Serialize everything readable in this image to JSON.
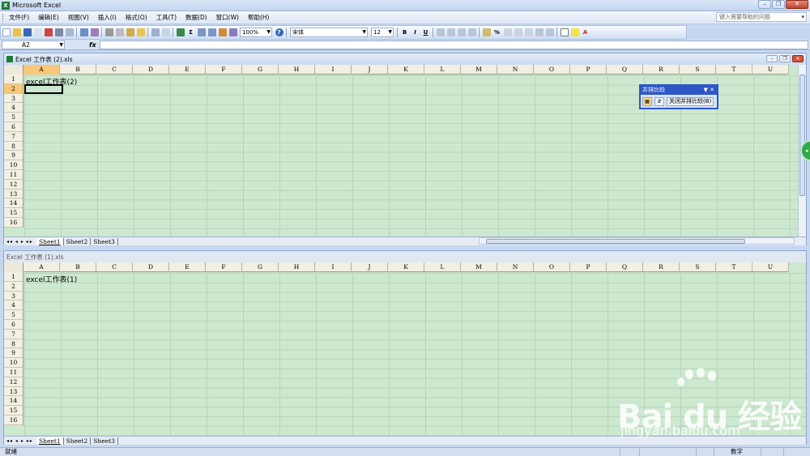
{
  "app": {
    "title": "Microsoft Excel",
    "icon": "excel-icon"
  },
  "menu": [
    "文件(F)",
    "编辑(E)",
    "视图(V)",
    "插入(I)",
    "格式(O)",
    "工具(T)",
    "数据(D)",
    "窗口(W)",
    "帮助(H)"
  ],
  "help_placeholder": "键入需要帮助的问题",
  "toolbar": {
    "zoom": "100%",
    "font": "宋体",
    "size": "12",
    "bold": "B",
    "italic": "I",
    "underline": "U",
    "sum": "Σ",
    "percent": "%"
  },
  "formula": {
    "namebox": "A2",
    "fx": "fx",
    "value": ""
  },
  "columns": [
    "A",
    "B",
    "C",
    "D",
    "E",
    "F",
    "G",
    "H",
    "I",
    "J",
    "K",
    "L",
    "M",
    "N",
    "O",
    "P",
    "Q",
    "R",
    "S",
    "T",
    "U"
  ],
  "rows": [
    "1",
    "2",
    "3",
    "4",
    "5",
    "6",
    "7",
    "8",
    "9",
    "10",
    "11",
    "12",
    "13",
    "14",
    "15",
    "16"
  ],
  "workbook_top": {
    "title": "Excel 工作表 (2).xls",
    "cell_a1": "excel工作表(2)",
    "sheets": [
      "Sheet1",
      "Sheet2",
      "Sheet3"
    ],
    "selected_col": "A",
    "selected_row": "2"
  },
  "workbook_bottom": {
    "title": "Excel 工作表 (1).xls",
    "cell_a1": "excel工作表(1)",
    "sheets": [
      "Sheet1",
      "Sheet2",
      "Sheet3"
    ]
  },
  "compare_toolbar": {
    "title": "并排比较",
    "close_label": "关闭并排比较(B)"
  },
  "status": {
    "left": "就绪",
    "num": "数字"
  },
  "watermark": {
    "brand": "Bai du 经验",
    "url": "jingyan.baidu.com"
  },
  "colors": {
    "grid_bg": "#cce8cf",
    "header_bg": "#f2efe3",
    "selected_header": "#f8c777",
    "compare_blue": "#2d56c7"
  }
}
